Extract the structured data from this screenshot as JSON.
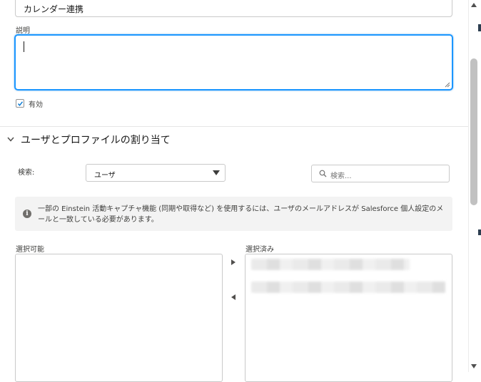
{
  "form": {
    "name_value": "カレンダー連携",
    "description_label": "説明",
    "description_value": "",
    "active_label": "有効",
    "active_checked": true
  },
  "section": {
    "title": "ユーザとプロファイルの割り当て"
  },
  "search": {
    "label": "検索:",
    "type_selected": "ユーザ",
    "placeholder": "検索..."
  },
  "info": {
    "icon": "info-icon",
    "text": "一部の Einstein 活動キャプチャ機能 (同期や取得など) を使用するには、ユーザのメールアドレスが Salesforce 個人設定のメールと一致している必要があります。"
  },
  "dual_list": {
    "available_label": "選択可能",
    "selected_label": "選択済み",
    "available_items": [],
    "selected_items_count_visible": 2
  },
  "colors": {
    "focus_border": "#1b96ff",
    "info_bg": "#f3f3f3",
    "border": "#c9c9c9"
  }
}
